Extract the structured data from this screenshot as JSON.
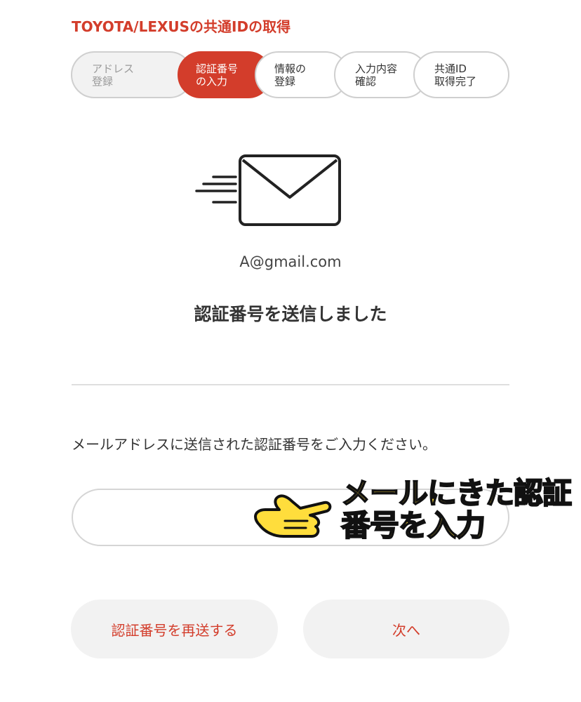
{
  "header": {
    "title": "TOYOTA/LEXUSの共通IDの取得"
  },
  "stepper": {
    "steps": [
      {
        "label": "アドレス\n登録",
        "state": "done"
      },
      {
        "label": "認証番号\nの入力",
        "state": "current"
      },
      {
        "label": "情報の\n登録",
        "state": "todo"
      },
      {
        "label": "入力内容\n確認",
        "state": "todo"
      },
      {
        "label": "共通ID\n取得完了",
        "state": "todo"
      }
    ]
  },
  "main": {
    "icon": "envelope-send-icon",
    "email": "A@gmail.com",
    "heading": "認証番号を送信しました",
    "instruction": "メールアドレスに送信された認証番号をご入力ください。",
    "code_input": {
      "value": "",
      "placeholder": ""
    }
  },
  "annotation": {
    "icon": "pointing-hand-icon",
    "text": "メールにきた認証\n番号を入力"
  },
  "buttons": {
    "resend_label": "認証番号を再送する",
    "next_label": "次へ"
  },
  "colors": {
    "accent": "#d33d2b",
    "annotation": "#ffdd3c"
  }
}
